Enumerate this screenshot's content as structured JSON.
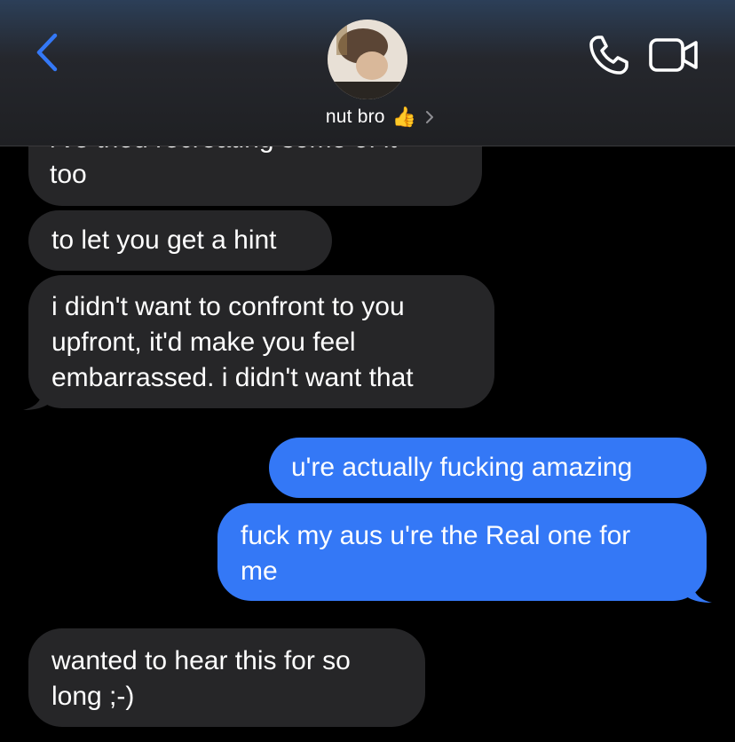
{
  "header": {
    "contact_name": "nut bro",
    "contact_emoji": "👍",
    "icons": {
      "back": "chevron-left-icon",
      "chevron": "chevron-right-icon",
      "call": "phone-icon",
      "video": "video-camera-icon"
    },
    "accent_color": "#3478f6"
  },
  "messages": [
    {
      "from": "them",
      "lines": [
        "i've tried recreating some of it",
        "too"
      ]
    },
    {
      "from": "them",
      "lines": [
        "to let you get a hint"
      ]
    },
    {
      "from": "them",
      "lines": [
        "i didn't want to confront to you",
        "upfront, it'd make you feel",
        "embarrassed. i didn't want that"
      ]
    },
    {
      "from": "me",
      "lines": [
        "u're actually fucking amazing"
      ]
    },
    {
      "from": "me",
      "lines": [
        "fuck my aus u're the Real one for",
        "me"
      ]
    },
    {
      "from": "them",
      "lines": [
        "wanted to hear this for so",
        "long ;-)"
      ]
    }
  ],
  "colors": {
    "received_bubble": "#262628",
    "sent_bubble": "#3478f6",
    "background": "#000000"
  }
}
